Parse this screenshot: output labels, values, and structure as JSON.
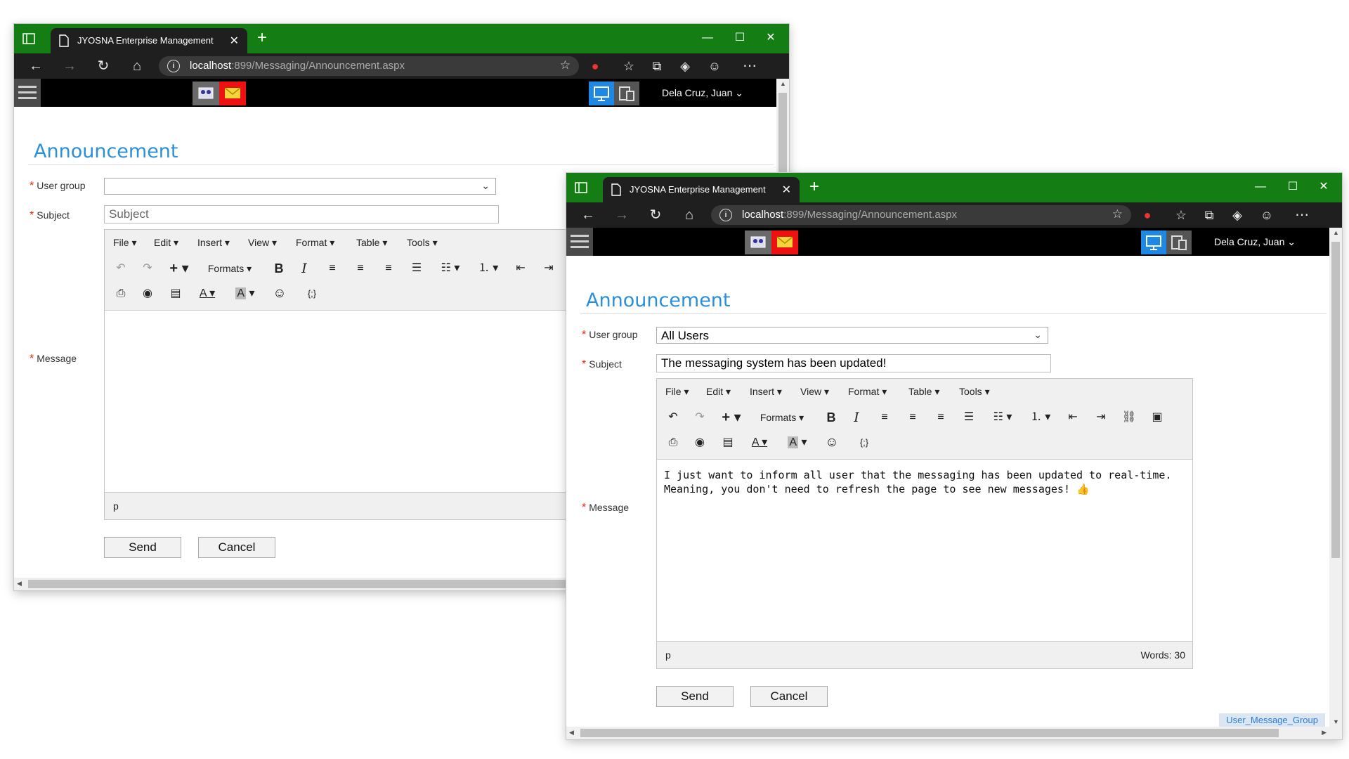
{
  "windows": [
    {
      "tab_title": "JYOSNA Enterprise Management",
      "url_host": "localhost",
      "url_path": ":899/Messaging/Announcement.aspx",
      "user": "Dela Cruz, Juan",
      "page_title": "Announcement",
      "form": {
        "user_group_label": "User group",
        "user_group_value": "",
        "subject_label": "Subject",
        "subject_value": "",
        "subject_placeholder": "Subject",
        "message_label": "Message",
        "message_text": "",
        "status_path": "p",
        "word_count": ""
      },
      "buttons": {
        "send": "Send",
        "cancel": "Cancel"
      },
      "footer_tag": ""
    },
    {
      "tab_title": "JYOSNA Enterprise Management",
      "url_host": "localhost",
      "url_path": ":899/Messaging/Announcement.aspx",
      "user": "Dela Cruz, Juan",
      "page_title": "Announcement",
      "form": {
        "user_group_label": "User group",
        "user_group_value": "All Users",
        "subject_label": "Subject",
        "subject_value": "The messaging system has been updated!",
        "subject_placeholder": "Subject",
        "message_label": "Message",
        "message_text": "I just want to inform all user that the messaging has been updated to real-time. Meaning, you don't need to refresh the page to see new messages! 👍",
        "status_path": "p",
        "word_count": "Words: 30"
      },
      "buttons": {
        "send": "Send",
        "cancel": "Cancel"
      },
      "footer_tag": "User_Message_Group"
    }
  ],
  "editor": {
    "menus": [
      "File",
      "Edit",
      "Insert",
      "View",
      "Format",
      "Table",
      "Tools"
    ],
    "formats_label": "Formats",
    "bold": "B",
    "italic": "I",
    "font_color": "A",
    "bg_color": "A",
    "code": "{;}"
  },
  "icons": [
    "panel-icon",
    "doc-icon",
    "close-icon",
    "plus-icon",
    "minimize-icon",
    "maximize-icon",
    "back-icon",
    "forward-icon",
    "refresh-icon",
    "home-icon",
    "info-icon",
    "star-icon",
    "extension-icon",
    "favorites-icon",
    "collections-icon",
    "profile-icon",
    "more-icon",
    "hamburger-icon",
    "people-icon",
    "mail-icon",
    "desktop-icon",
    "mobile-icon",
    "chevron-down-icon"
  ],
  "colors": {
    "titlebar": "#147e14",
    "accent": "#2b90d9",
    "required": "#e21111",
    "mail": "#e11111",
    "desktop_active": "#1e88e5"
  }
}
